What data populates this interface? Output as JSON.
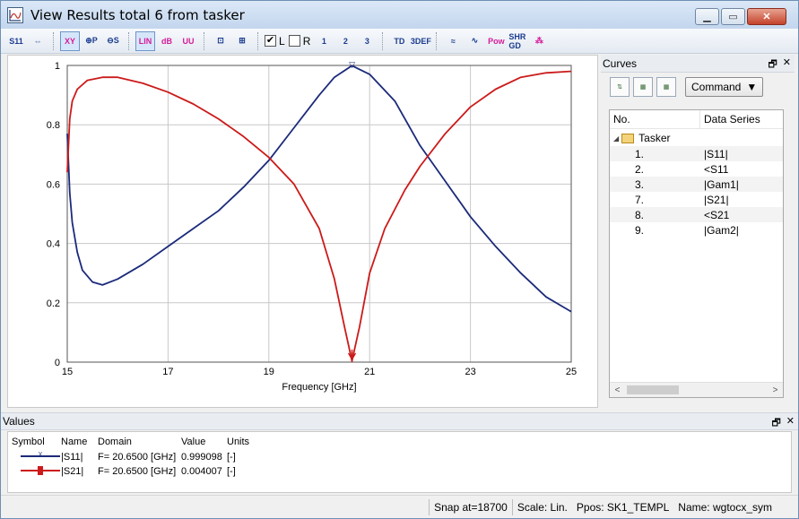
{
  "window": {
    "title": "View Results total 6 from tasker",
    "app_icon": "chart-icon"
  },
  "toolbar": {
    "buttons": [
      {
        "label": "S11",
        "icon": "s11-axis-icon"
      },
      {
        "label": "⇔",
        "icon": "fit-axis-icon"
      },
      {
        "label": "XY",
        "icon": "xy-plot-icon"
      },
      {
        "label": "⊕P",
        "icon": "polar-plot-icon"
      },
      {
        "label": "⊖S",
        "icon": "smith-chart-icon"
      },
      {
        "label": "LIN",
        "icon": "linear-scale-icon"
      },
      {
        "label": "dB",
        "icon": "db-scale-icon"
      },
      {
        "label": "UU",
        "icon": "unit-scale-icon"
      },
      {
        "label": "⊡",
        "icon": "zoom-icon"
      },
      {
        "label": "⊞",
        "icon": "zoom-fit-icon"
      }
    ],
    "check_l": "L",
    "check_r": "R",
    "marker_buttons": [
      "1",
      "2",
      "3"
    ],
    "extra_buttons": [
      "TD",
      "3DEF",
      "≈",
      "∿",
      "Pow",
      "SHR GD",
      "⁂"
    ]
  },
  "plot": {
    "xlabel": "Frequency [GHz]",
    "marker_glyph": "▽"
  },
  "chart_data": {
    "type": "line",
    "title": "",
    "xlabel": "Frequency [GHz]",
    "ylabel": "",
    "xlim": [
      15,
      25
    ],
    "ylim": [
      0,
      1
    ],
    "x_ticks": [
      "15",
      "17",
      "19",
      "21",
      "23",
      "25"
    ],
    "y_ticks": [
      "0",
      "0.2",
      "0.4",
      "0.6",
      "0.8",
      "1"
    ],
    "grid": true,
    "marker_x": 20.65,
    "series": [
      {
        "name": "|S11|",
        "color": "#1b2a7a",
        "points": [
          [
            15,
            0.77
          ],
          [
            15.05,
            0.57
          ],
          [
            15.1,
            0.47
          ],
          [
            15.2,
            0.37
          ],
          [
            15.3,
            0.31
          ],
          [
            15.5,
            0.27
          ],
          [
            15.7,
            0.26
          ],
          [
            16,
            0.28
          ],
          [
            16.5,
            0.33
          ],
          [
            17,
            0.39
          ],
          [
            17.5,
            0.45
          ],
          [
            18,
            0.51
          ],
          [
            18.5,
            0.59
          ],
          [
            19,
            0.68
          ],
          [
            19.5,
            0.79
          ],
          [
            20,
            0.9
          ],
          [
            20.3,
            0.96
          ],
          [
            20.65,
            0.999
          ],
          [
            21,
            0.97
          ],
          [
            21.5,
            0.88
          ],
          [
            22,
            0.73
          ],
          [
            22.5,
            0.61
          ],
          [
            23,
            0.49
          ],
          [
            23.5,
            0.39
          ],
          [
            24,
            0.3
          ],
          [
            24.5,
            0.22
          ],
          [
            25,
            0.17
          ]
        ]
      },
      {
        "name": "|S21|",
        "color": "#cc1a1a",
        "points": [
          [
            15,
            0.64
          ],
          [
            15.05,
            0.82
          ],
          [
            15.1,
            0.88
          ],
          [
            15.2,
            0.92
          ],
          [
            15.4,
            0.95
          ],
          [
            15.7,
            0.96
          ],
          [
            16,
            0.96
          ],
          [
            16.5,
            0.94
          ],
          [
            17,
            0.91
          ],
          [
            17.5,
            0.87
          ],
          [
            18,
            0.82
          ],
          [
            18.5,
            0.76
          ],
          [
            19,
            0.69
          ],
          [
            19.5,
            0.6
          ],
          [
            20,
            0.45
          ],
          [
            20.3,
            0.28
          ],
          [
            20.5,
            0.12
          ],
          [
            20.65,
            0.004
          ],
          [
            20.8,
            0.12
          ],
          [
            21,
            0.3
          ],
          [
            21.3,
            0.45
          ],
          [
            21.7,
            0.58
          ],
          [
            22,
            0.66
          ],
          [
            22.5,
            0.77
          ],
          [
            23,
            0.86
          ],
          [
            23.5,
            0.92
          ],
          [
            24,
            0.96
          ],
          [
            24.5,
            0.975
          ],
          [
            25,
            0.98
          ]
        ]
      }
    ]
  },
  "curves": {
    "header": "Curves",
    "float_icon": "🗗",
    "close_icon": "✕",
    "command_label": "Command",
    "columns": [
      "No.",
      "Data Series"
    ],
    "root": "Tasker",
    "rows": [
      {
        "no": "1.",
        "series": "|S11|"
      },
      {
        "no": "2.",
        "series": "<S11"
      },
      {
        "no": "3.",
        "series": "|Gam1|"
      },
      {
        "no": "7.",
        "series": "|S21|"
      },
      {
        "no": "8.",
        "series": "<S21"
      },
      {
        "no": "9.",
        "series": "|Gam2|"
      }
    ]
  },
  "values": {
    "header": "Values",
    "columns": [
      "Symbol",
      "Name",
      "Domain",
      "Value",
      "Units"
    ],
    "rows": [
      {
        "name": "|S11|",
        "domain": "F= 20.6500 [GHz]",
        "value": "0.999098",
        "units": "[-]",
        "color": "#1b2a7a"
      },
      {
        "name": "|S21|",
        "domain": "F= 20.6500 [GHz]",
        "value": "0.004007",
        "units": "[-]",
        "color": "#cc1a1a"
      }
    ]
  },
  "status": {
    "snap": "Snap at=18700",
    "scale": "Scale: Lin.",
    "ppos": "Ppos: SK1_TEMPL",
    "name": "Name: wgtocx_sym"
  }
}
